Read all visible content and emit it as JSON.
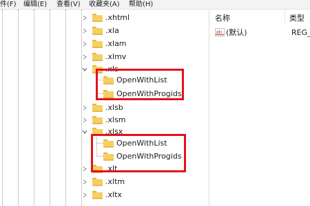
{
  "menu": [
    "件(F)",
    "编辑(E)",
    "查看(V)",
    "收藏夹(A)",
    "帮助(H)"
  ],
  "tree": [
    {
      "label": ".xhtml"
    },
    {
      "label": ".xla"
    },
    {
      "label": ".xlam"
    },
    {
      "label": ".xlmv"
    },
    {
      "label": ".xls"
    },
    {
      "label": "OpenWithList"
    },
    {
      "label": "OpenWithProgids"
    },
    {
      "label": ".xlsb"
    },
    {
      "label": ".xlsm"
    },
    {
      "label": ".xlsx"
    },
    {
      "label": "OpenWithList"
    },
    {
      "label": "OpenWithProgids"
    },
    {
      "label": ".xlt"
    },
    {
      "label": ".xltm"
    },
    {
      "label": ".xltx"
    }
  ],
  "columns": {
    "name": "名称",
    "type": "类型"
  },
  "values": [
    {
      "name": "(默认)",
      "type": "REG_"
    }
  ],
  "colors": {
    "highlight": "#e4111b",
    "folder": "#f6cf61"
  }
}
